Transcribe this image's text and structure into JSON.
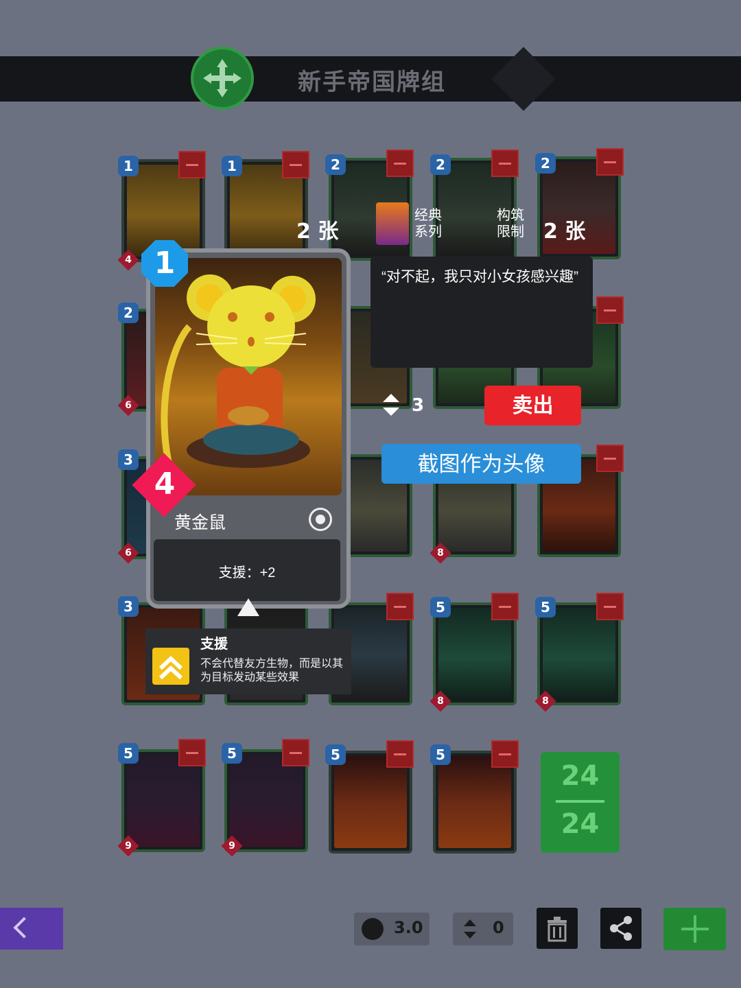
{
  "header": {
    "title": "新手帝国牌组",
    "emblem_icon": "four-way-arrows-icon",
    "emblem_color": "#1f7a33"
  },
  "deck": {
    "rows": [
      {
        "cards": [
          {
            "cost": "1",
            "power": "4",
            "art": "gold-mouse"
          },
          {
            "cost": "1",
            "power": "",
            "art": "gold-mouse"
          },
          {
            "cost": "2",
            "power": "",
            "art": "robot-green"
          },
          {
            "cost": "2",
            "power": "",
            "art": "robot-green"
          },
          {
            "cost": "2",
            "power": "",
            "art": "machine-red"
          }
        ]
      },
      {
        "cards": [
          {
            "cost": "2",
            "power": "6",
            "art": "red-figure"
          },
          {
            "cost": "",
            "power": "",
            "art": "weapon"
          },
          {
            "cost": "",
            "power": "",
            "art": "green-cannon"
          },
          {
            "cost": "",
            "power": "",
            "art": "green-cannon"
          }
        ]
      },
      {
        "cards": [
          {
            "cost": "3",
            "power": "6",
            "art": "blue-figure"
          },
          {
            "cost": "",
            "power": "",
            "art": "mech"
          },
          {
            "cost": "",
            "power": "8",
            "art": "mech"
          },
          {
            "cost": "",
            "power": "",
            "art": "fire-beast"
          }
        ]
      },
      {
        "cards": [
          {
            "cost": "3",
            "power": "",
            "art": "fire"
          },
          {
            "cost": "",
            "power": "",
            "art": "dark"
          },
          {
            "cost": "",
            "power": "",
            "art": "blue-gun"
          },
          {
            "cost": "5",
            "power": "8",
            "art": "green-jet"
          },
          {
            "cost": "5",
            "power": "8",
            "art": "green-jet"
          }
        ]
      },
      {
        "cards": [
          {
            "cost": "5",
            "power": "9",
            "art": "dark-samurai"
          },
          {
            "cost": "5",
            "power": "9",
            "art": "dark-samurai"
          },
          {
            "cost": "5",
            "power": "",
            "art": "fire-fist"
          },
          {
            "cost": "5",
            "power": "",
            "art": "fire-fist"
          }
        ]
      }
    ],
    "counter_top": "24",
    "counter_bottom": "24"
  },
  "detail": {
    "cost": "1",
    "power": "4",
    "name": "黄金鼠",
    "ability": "支援：+2",
    "count_left": "2 张",
    "series": "经典\n系列",
    "limit_label": "构筑\n限制",
    "count_right": "2 张",
    "quote": "“对不起，我只对小女孩感兴趣”",
    "craft_value": "3",
    "sell_label": "卖出",
    "avatar_label": "截图作为头像"
  },
  "tooltip": {
    "title": "支援",
    "description": "不会代替友方生物，而是以其为目标发动某些效果"
  },
  "toolbar": {
    "currency_value": "3.0",
    "craft_value": "0"
  },
  "colors": {
    "sell": "#e8232a",
    "avatar": "#2a8ed8",
    "add": "#238a33",
    "back": "#5a3aa8"
  }
}
